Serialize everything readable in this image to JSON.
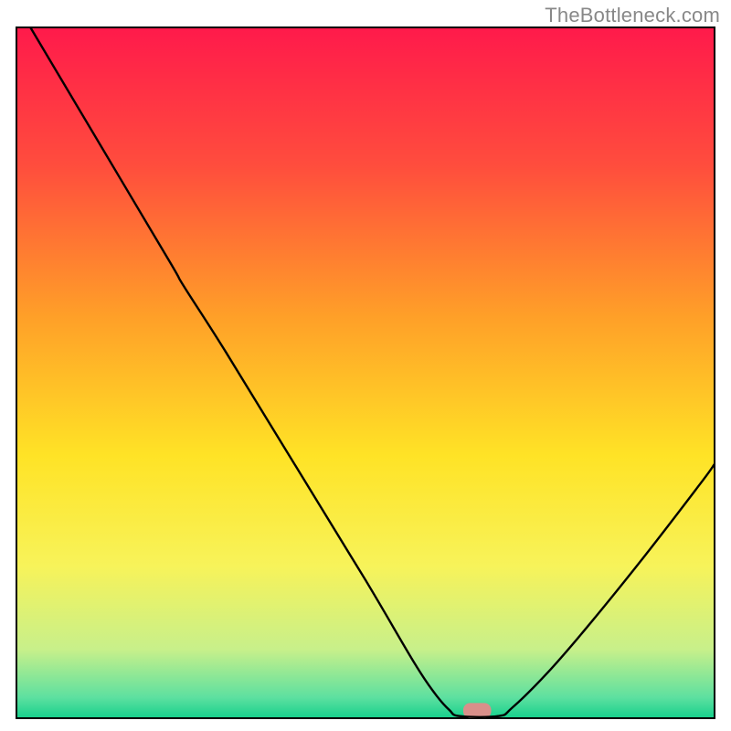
{
  "attribution": "TheBottleneck.com",
  "chart_data": {
    "type": "line",
    "title": "",
    "xlabel": "",
    "ylabel": "",
    "xlim": [
      0,
      100
    ],
    "ylim": [
      0,
      100
    ],
    "grid": false,
    "legend": false,
    "background_gradient_stops": [
      {
        "offset": 0.0,
        "color": "#ff1a4b"
      },
      {
        "offset": 0.2,
        "color": "#ff4d3d"
      },
      {
        "offset": 0.42,
        "color": "#ffa028"
      },
      {
        "offset": 0.62,
        "color": "#ffe326"
      },
      {
        "offset": 0.78,
        "color": "#f7f35a"
      },
      {
        "offset": 0.9,
        "color": "#c8f08a"
      },
      {
        "offset": 0.97,
        "color": "#5de0a0"
      },
      {
        "offset": 1.0,
        "color": "#16d08c"
      }
    ],
    "marker": {
      "x": 66,
      "y": 0,
      "w": 4,
      "h": 2.2,
      "color": "#d98f8a",
      "rx": 1.0
    },
    "series": [
      {
        "name": "curve",
        "color": "#000000",
        "points": [
          {
            "x": 2.0,
            "y": 100.0
          },
          {
            "x": 12.0,
            "y": 83.0
          },
          {
            "x": 22.0,
            "y": 66.0
          },
          {
            "x": 24.0,
            "y": 62.5
          },
          {
            "x": 30.0,
            "y": 53.0
          },
          {
            "x": 40.0,
            "y": 36.5
          },
          {
            "x": 50.0,
            "y": 20.0
          },
          {
            "x": 57.0,
            "y": 8.0
          },
          {
            "x": 60.0,
            "y": 3.5
          },
          {
            "x": 62.0,
            "y": 1.2
          },
          {
            "x": 63.5,
            "y": 0.3
          },
          {
            "x": 69.0,
            "y": 0.3
          },
          {
            "x": 71.0,
            "y": 1.5
          },
          {
            "x": 76.0,
            "y": 6.5
          },
          {
            "x": 82.0,
            "y": 13.5
          },
          {
            "x": 90.0,
            "y": 23.5
          },
          {
            "x": 98.0,
            "y": 34.0
          },
          {
            "x": 100.0,
            "y": 36.8
          }
        ]
      }
    ]
  }
}
